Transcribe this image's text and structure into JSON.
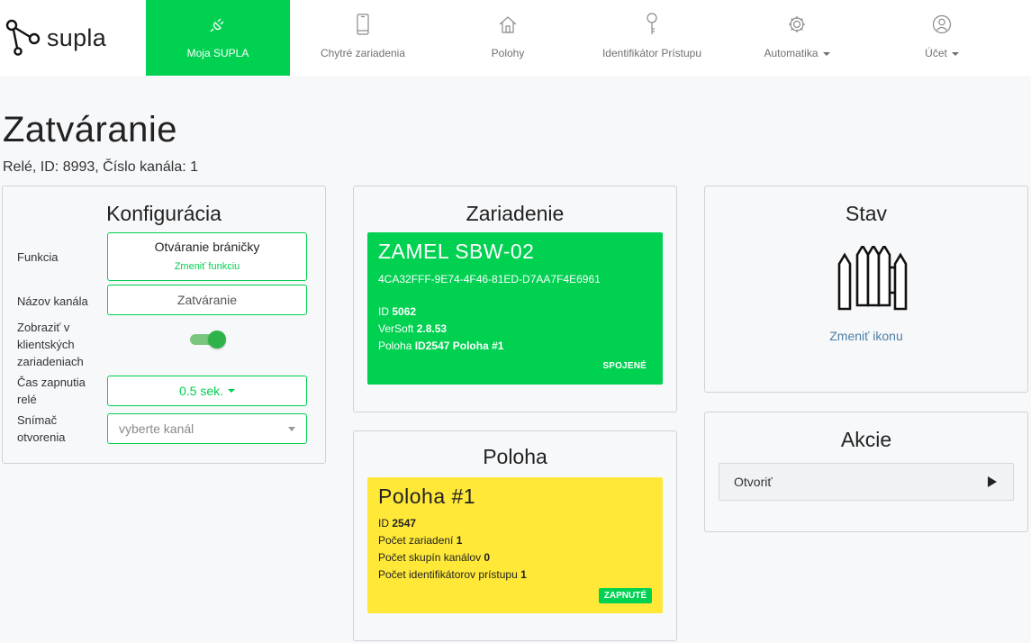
{
  "app": {
    "brand": "supla"
  },
  "nav": {
    "items": [
      {
        "label": "Moja SUPLA",
        "icon": "plug-icon",
        "active": true
      },
      {
        "label": "Chytré zariadenia",
        "icon": "smartphone-icon"
      },
      {
        "label": "Polohy",
        "icon": "home-icon"
      },
      {
        "label": "Identifikátor Prístupu",
        "icon": "key-icon"
      },
      {
        "label": "Automatika",
        "icon": "gear-icon",
        "dropdown": true
      },
      {
        "label": "Účet",
        "icon": "user-icon",
        "dropdown": true
      }
    ]
  },
  "header": {
    "title": "Zatváranie",
    "subtitle": "Relé, ID: 8993, Číslo kanála: 1"
  },
  "config": {
    "title": "Konfigurácia",
    "function_label": "Funkcia",
    "function_value": "Otváranie bráničky",
    "function_change": "Zmeniť funkciu",
    "name_label": "Názov kanála",
    "name_value": "Zatváranie",
    "show_label": "Zobraziť v klientských zariadeniach",
    "show_enabled": true,
    "time_label": "Čas zapnutia relé",
    "time_value": "0.5 sek.",
    "sensor_label": "Snímač otvorenia",
    "sensor_placeholder": "vyberte kanál"
  },
  "device": {
    "title": "Zariadenie",
    "name": "ZAMEL SBW-02",
    "guid": "4CA32FFF-9E74-4F46-81ED-D7AA7F4E6961",
    "id_label": "ID",
    "id_value": "5062",
    "version_label": "VerSoft",
    "version_value": "2.8.53",
    "location_label": "Poloha",
    "location_value": "ID2547 Poloha #1",
    "status": "SPOJENÉ",
    "color": "#00d151"
  },
  "location": {
    "title": "Poloha",
    "name": "Poloha #1",
    "id_label": "ID",
    "id_value": "2547",
    "devices_label": "Počet zariadení",
    "devices_value": "1",
    "groups_label": "Počet skupín kanálov",
    "groups_value": "0",
    "aids_label": "Počet identifikátorov prístupu",
    "aids_value": "1",
    "status": "ZAPNUTÉ",
    "color": "#ffe838"
  },
  "state": {
    "title": "Stav",
    "icon": "gate-closed-icon",
    "change_icon_link": "Zmeniť ikonu"
  },
  "actions": {
    "title": "Akcie",
    "items": [
      {
        "label": "Otvoriť",
        "icon": "play-icon"
      }
    ]
  }
}
